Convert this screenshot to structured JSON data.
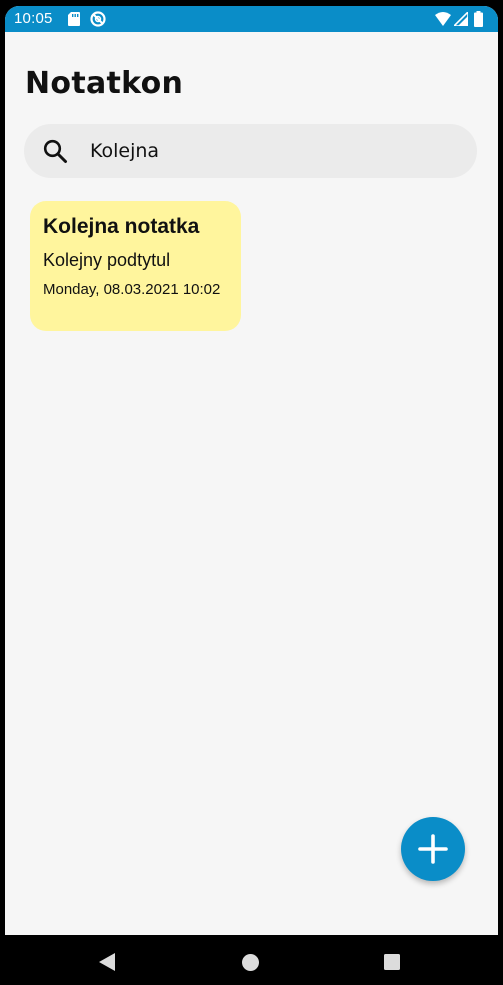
{
  "status_bar": {
    "time": "10:05",
    "icons": [
      "sd-card-icon",
      "do-not-disturb-icon",
      "wifi-icon",
      "signal-icon",
      "battery-icon"
    ],
    "background_color": "#0a8dc8"
  },
  "app": {
    "title": "Notatkon"
  },
  "search": {
    "value": "Kolejna",
    "icon": "search-icon"
  },
  "notes": [
    {
      "title": "Kolejna notatka",
      "subtitle": "Kolejny podtytul",
      "date": "Monday, 08.03.2021 10:02",
      "color": "#fff59d"
    }
  ],
  "fab": {
    "icon": "plus-icon",
    "color": "#0a8dc8"
  },
  "nav_bar": {
    "buttons": [
      "back-icon",
      "home-icon",
      "recents-icon"
    ]
  }
}
